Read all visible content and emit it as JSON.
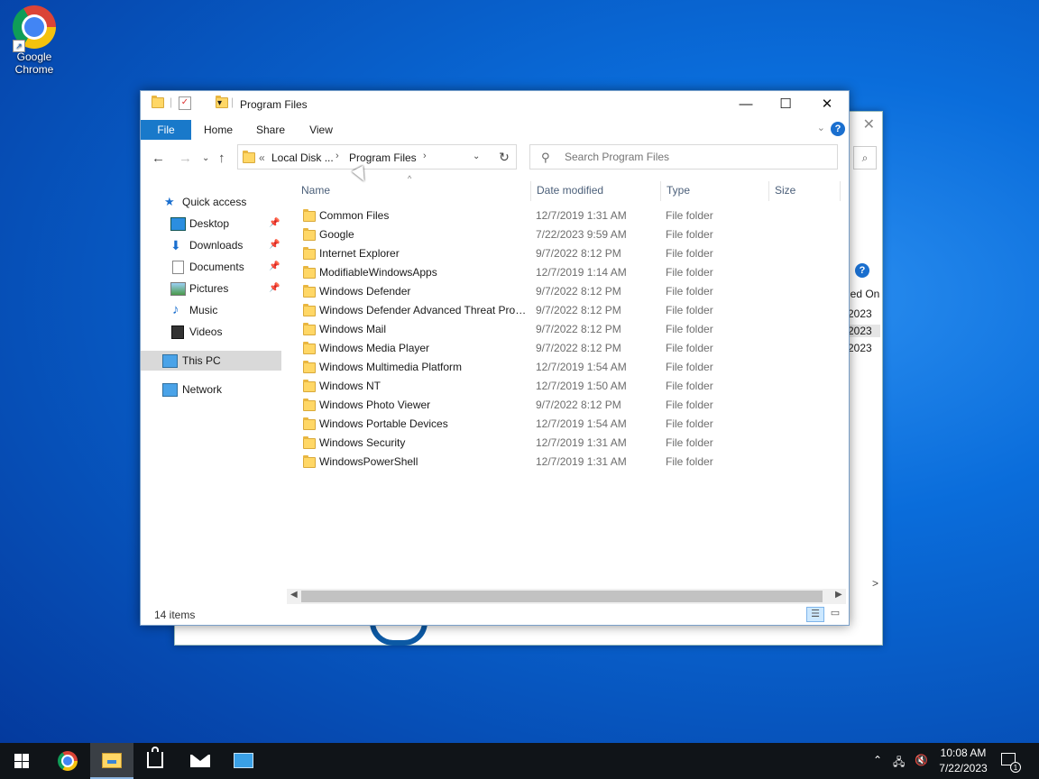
{
  "desktop": {
    "icons": [
      {
        "label": "Google Chrome",
        "icon": "chrome-icon"
      }
    ]
  },
  "background_window": {
    "column_header_partial": "led On",
    "rows_partial": [
      "2023",
      "2023",
      "2023"
    ]
  },
  "window": {
    "title": "Program Files",
    "controls": {
      "minimize": "—",
      "maximize": "☐",
      "close": "✕"
    }
  },
  "ribbon": {
    "tabs": [
      "File",
      "Home",
      "Share",
      "View"
    ],
    "help": "?"
  },
  "address": {
    "prefix": "«",
    "crumbs": [
      "Local Disk ...",
      "Program Files"
    ],
    "search_placeholder": "Search Program Files"
  },
  "nav_pane": {
    "quick_access": "Quick access",
    "pinned": [
      {
        "label": "Desktop",
        "icon": "desktop-icon"
      },
      {
        "label": "Downloads",
        "icon": "downloads-icon"
      },
      {
        "label": "Documents",
        "icon": "documents-icon"
      },
      {
        "label": "Pictures",
        "icon": "pictures-icon"
      }
    ],
    "other": [
      {
        "label": "Music",
        "icon": "music-icon"
      },
      {
        "label": "Videos",
        "icon": "videos-icon"
      }
    ],
    "this_pc": "This PC",
    "network": "Network"
  },
  "columns": [
    "Name",
    "Date modified",
    "Type",
    "Size"
  ],
  "files": [
    {
      "name": "Common Files",
      "date": "12/7/2019 1:31 AM",
      "type": "File folder"
    },
    {
      "name": "Google",
      "date": "7/22/2023 9:59 AM",
      "type": "File folder"
    },
    {
      "name": "Internet Explorer",
      "date": "9/7/2022 8:12 PM",
      "type": "File folder"
    },
    {
      "name": "ModifiableWindowsApps",
      "date": "12/7/2019 1:14 AM",
      "type": "File folder"
    },
    {
      "name": "Windows Defender",
      "date": "9/7/2022 8:12 PM",
      "type": "File folder"
    },
    {
      "name": "Windows Defender Advanced Threat Prot...",
      "date": "9/7/2022 8:12 PM",
      "type": "File folder"
    },
    {
      "name": "Windows Mail",
      "date": "9/7/2022 8:12 PM",
      "type": "File folder"
    },
    {
      "name": "Windows Media Player",
      "date": "9/7/2022 8:12 PM",
      "type": "File folder"
    },
    {
      "name": "Windows Multimedia Platform",
      "date": "12/7/2019 1:54 AM",
      "type": "File folder"
    },
    {
      "name": "Windows NT",
      "date": "12/7/2019 1:50 AM",
      "type": "File folder"
    },
    {
      "name": "Windows Photo Viewer",
      "date": "9/7/2022 8:12 PM",
      "type": "File folder"
    },
    {
      "name": "Windows Portable Devices",
      "date": "12/7/2019 1:54 AM",
      "type": "File folder"
    },
    {
      "name": "Windows Security",
      "date": "12/7/2019 1:31 AM",
      "type": "File folder"
    },
    {
      "name": "WindowsPowerShell",
      "date": "12/7/2019 1:31 AM",
      "type": "File folder"
    }
  ],
  "status": {
    "item_count": "14 items"
  },
  "taskbar": {
    "apps": [
      "start-icon",
      "chrome-icon",
      "file-explorer-icon",
      "store-icon",
      "mail-icon",
      "app-icon"
    ],
    "time": "10:08 AM",
    "date": "7/22/2023",
    "notification_count": "1"
  }
}
